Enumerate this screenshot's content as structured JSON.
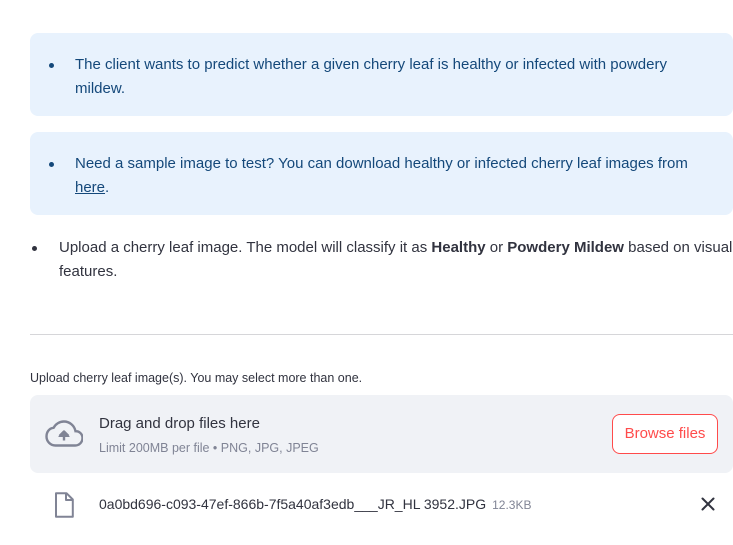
{
  "info_boxes": [
    {
      "text": "The client wants to predict whether a given cherry leaf is healthy or infected with powdery mildew."
    },
    {
      "text": "Need a sample image to test? You can download healthy or infected cherry leaf images from ",
      "link_text": "here",
      "suffix": "."
    }
  ],
  "upload_note": {
    "part1": "Upload a cherry leaf image. The model will classify it as ",
    "bold1": "Healthy",
    "part2": " or ",
    "bold2": "Powdery Mildew",
    "part3": " based on visual features."
  },
  "uploader": {
    "label": "Upload cherry leaf image(s). You may select more than one.",
    "drop_title": "Drag and drop files here",
    "drop_subtitle": "Limit 200MB per file • PNG, JPG, JPEG",
    "browse_label": "Browse files",
    "icon": "cloud-upload-icon"
  },
  "uploaded_file": {
    "name": "0a0bd696-c093-47ef-866b-7f5a40af3edb___JR_HL 3952.JPG",
    "size": "12.3KB"
  },
  "colors": {
    "info_bg": "#e8f2fd",
    "info_text": "#14487a",
    "accent": "#ff4b4b",
    "dropzone_bg": "#f0f2f6"
  }
}
